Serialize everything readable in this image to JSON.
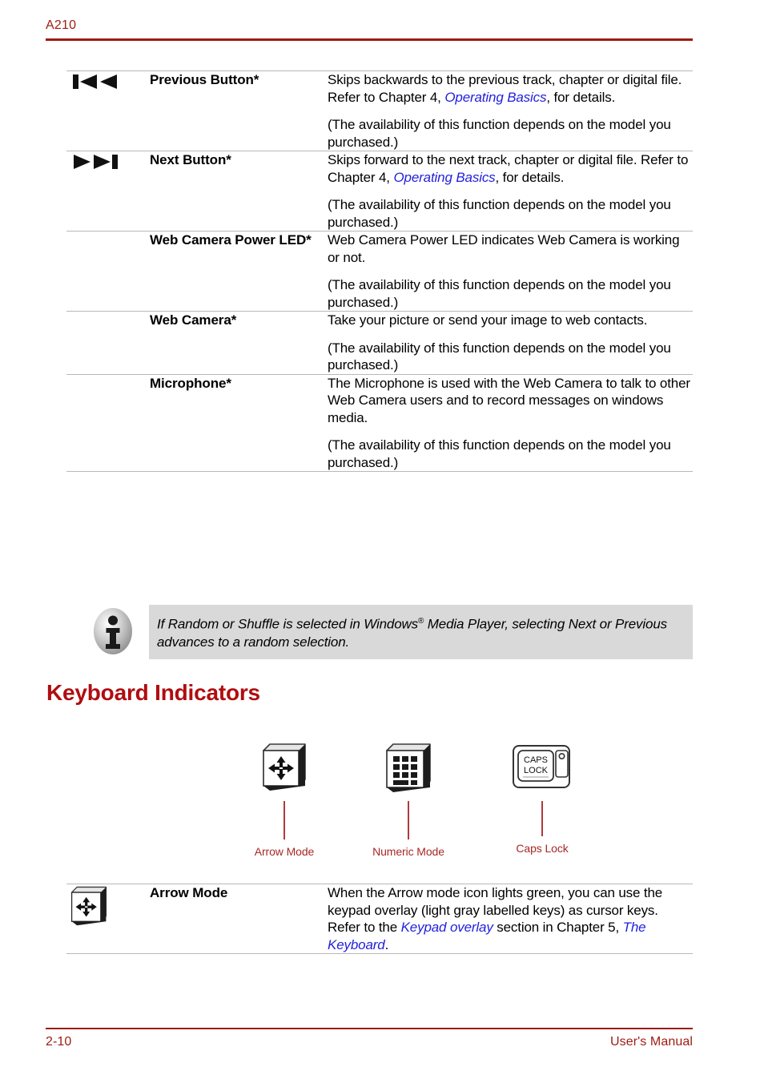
{
  "header": {
    "model_label": "A210"
  },
  "top_table": {
    "rows": [
      {
        "icon": "previous-track-icon",
        "term": "Previous Button*",
        "paragraphs": [
          {
            "segments": [
              {
                "text": "Skips backwards to the previous track, chapter or digital file. Refer to Chapter 4, ",
                "style": "plain"
              },
              {
                "text": "Operating Basics",
                "style": "link"
              },
              {
                "text": ", for details.",
                "style": "plain"
              }
            ]
          },
          {
            "segments": [
              {
                "text": "(The availability of this function depends on the model you purchased.)",
                "style": "plain"
              }
            ]
          }
        ]
      },
      {
        "icon": "next-track-icon",
        "term": "Next Button*",
        "paragraphs": [
          {
            "segments": [
              {
                "text": "Skips forward to the next track, chapter or digital file. Refer to Chapter 4, ",
                "style": "plain"
              },
              {
                "text": "Operating Basics",
                "style": "link"
              },
              {
                "text": ", for details.",
                "style": "plain"
              }
            ]
          },
          {
            "segments": [
              {
                "text": "(The availability of this function depends on the model you purchased.)",
                "style": "plain"
              }
            ]
          }
        ]
      },
      {
        "icon": "",
        "term": "Web Camera Power LED*",
        "paragraphs": [
          {
            "segments": [
              {
                "text": "Web Camera Power LED indicates Web Camera is working or not.",
                "style": "plain"
              }
            ]
          },
          {
            "segments": [
              {
                "text": "(The availability of this function depends on the model you purchased.)",
                "style": "plain"
              }
            ]
          }
        ]
      },
      {
        "icon": "",
        "term": "Web Camera*",
        "paragraphs": [
          {
            "segments": [
              {
                "text": "Take your picture or send your image to web contacts.",
                "style": "plain"
              }
            ]
          },
          {
            "segments": [
              {
                "text": "(The availability of this function depends on the model you purchased.)",
                "style": "plain"
              }
            ]
          }
        ]
      },
      {
        "icon": "",
        "term": "Microphone*",
        "paragraphs": [
          {
            "segments": [
              {
                "text": "The Microphone is used with the Web Camera to talk to other Web Camera users and to record messages on windows media.",
                "style": "plain"
              }
            ]
          },
          {
            "segments": [
              {
                "text": "(The availability of this function depends on the model you purchased.)",
                "style": "plain"
              }
            ]
          }
        ]
      }
    ]
  },
  "note": {
    "icon": "info-icon",
    "text_before_sup": "If Random or Shuffle is selected in Windows",
    "sup": "®",
    "text_after_sup": " Media Player, selecting Next or Previous advances to a random selection.",
    "background": "#d9d9d9"
  },
  "section": {
    "heading": "Keyboard Indicators",
    "heading_color": "#b00d10"
  },
  "indicators": {
    "items": [
      {
        "icon": "arrow-mode-key-icon",
        "label": "Arrow Mode"
      },
      {
        "icon": "numeric-mode-key-icon",
        "label": "Numeric Mode"
      },
      {
        "icon": "caps-lock-key-icon",
        "label": "Caps Lock"
      }
    ],
    "caps_lock_key_text_line1": "CAPS",
    "caps_lock_key_text_line2": "LOCK",
    "leader_color": "#b03a3a",
    "label_color": "#a82824"
  },
  "bottom_table": {
    "rows": [
      {
        "icon": "arrow-mode-key-icon",
        "term": "Arrow Mode",
        "paragraphs": [
          {
            "segments": [
              {
                "text": "When the Arrow mode icon lights green, you can use the keypad overlay (light gray labelled keys) as cursor keys. Refer to the ",
                "style": "plain"
              },
              {
                "text": "Keypad overlay",
                "style": "link"
              },
              {
                "text": " section in Chapter 5, ",
                "style": "plain"
              },
              {
                "text": "The Keyboard",
                "style": "link"
              },
              {
                "text": ".",
                "style": "plain"
              }
            ]
          }
        ]
      }
    ]
  },
  "footer": {
    "page_number": "2-10",
    "manual_label": "User's Manual",
    "color": "#9e1b12"
  }
}
